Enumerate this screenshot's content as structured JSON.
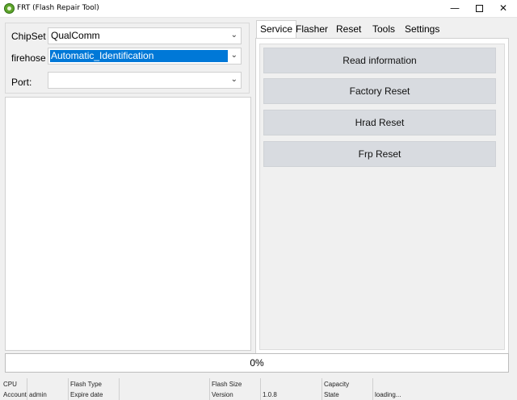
{
  "window": {
    "title": "FRT (Flash Repair Tool)",
    "minimize": "—",
    "close": "✕"
  },
  "form": {
    "chipset_label": "ChipSet",
    "chipset_value": "QualComm",
    "firehose_label": "firehose",
    "firehose_value": "Automatic_Identification",
    "port_label": "Port:",
    "port_value": ""
  },
  "tabs": [
    {
      "label": "Service",
      "active": true
    },
    {
      "label": "Flasher",
      "active": false
    },
    {
      "label": "Reset",
      "active": false
    },
    {
      "label": "Tools",
      "active": false
    },
    {
      "label": "Settings",
      "active": false
    }
  ],
  "service_buttons": [
    "Read information",
    "Factory Reset",
    "Hrad Reset",
    "Frp Reset"
  ],
  "progress": {
    "value": 0,
    "text": "0%",
    "color": "#06b025"
  },
  "status": {
    "cpu_label": "CPU",
    "cpu_value": "",
    "account_label": "Account",
    "account_value": "admin",
    "flash_type_label": "Flash Type",
    "flash_type_value": "",
    "expire_label": "Expire date",
    "expire_value": "",
    "flash_size_label": "Flash Size",
    "flash_size_value": "",
    "version_label": "Version",
    "version_value": "1.0.8",
    "capacity_label": "Capacity",
    "capacity_value": "",
    "state_label": "State",
    "state_value": "loading..."
  },
  "colors": {
    "selection": "#0078d7",
    "button": "#d8dbe0"
  }
}
